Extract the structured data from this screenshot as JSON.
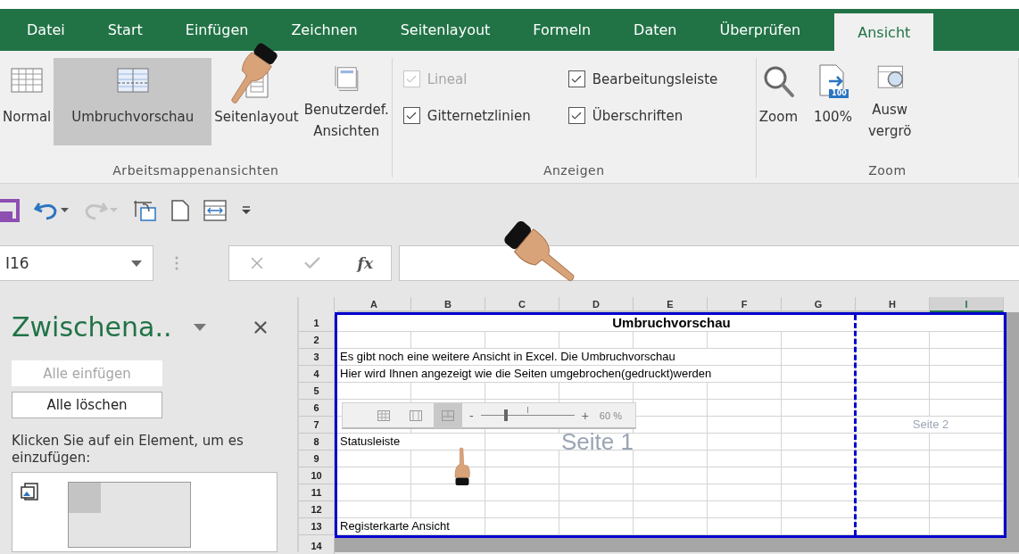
{
  "tabs": [
    {
      "label": "Datei",
      "selected": false
    },
    {
      "label": "Start",
      "selected": false
    },
    {
      "label": "Einfügen",
      "selected": false
    },
    {
      "label": "Zeichnen",
      "selected": false
    },
    {
      "label": "Seitenlayout",
      "selected": false
    },
    {
      "label": "Formeln",
      "selected": false
    },
    {
      "label": "Daten",
      "selected": false
    },
    {
      "label": "Überprüfen",
      "selected": false
    },
    {
      "label": "Ansicht",
      "selected": true
    }
  ],
  "ribbon": {
    "groups": [
      {
        "kind": "buttons",
        "label": "Arbeitsmappenansichten",
        "buttons": [
          {
            "kind": "normal",
            "lines": [
              "Normal"
            ],
            "selected": false
          },
          {
            "kind": "pagebreak",
            "lines": [
              "Umbruchvorschau"
            ],
            "selected": true
          },
          {
            "kind": "pagelayout",
            "lines": [
              "Seitenlayout"
            ],
            "selected": false
          },
          {
            "kind": "custom",
            "lines": [
              "Benutzerdef.",
              "Ansichten"
            ],
            "selected": false
          }
        ]
      },
      {
        "kind": "checks",
        "label": "Anzeigen",
        "checkboxes": [
          {
            "label": "Lineal",
            "checked": true,
            "disabled": true
          },
          {
            "label": "Bearbeitungsleiste",
            "checked": true,
            "disabled": false
          },
          {
            "label": "Gitternetzlinien",
            "checked": true,
            "disabled": false
          },
          {
            "label": "Überschriften",
            "checked": true,
            "disabled": false
          }
        ]
      },
      {
        "kind": "buttons",
        "label": "Zoom",
        "buttons": [
          {
            "kind": "zoom",
            "lines": [
              "Zoom"
            ],
            "selected": false
          },
          {
            "kind": "hundred",
            "lines": [
              "100%"
            ],
            "icon_text": "100",
            "selected": false
          },
          {
            "kind": "selection",
            "lines": [
              "Ausw",
              "vergrö"
            ],
            "selected": false
          }
        ]
      }
    ]
  },
  "quick_access": [
    {
      "kind": "save",
      "disabled": false
    },
    {
      "kind": "undo",
      "disabled": false
    },
    {
      "kind": "redo",
      "disabled": true
    },
    {
      "kind": "touch",
      "disabled": false
    },
    {
      "kind": "new",
      "disabled": false
    },
    {
      "kind": "freeze",
      "disabled": false
    },
    {
      "kind": "customize",
      "disabled": false
    }
  ],
  "formula_bar": {
    "name_box": "I16",
    "function_label": "fx"
  },
  "pane": {
    "title": "Zwischena..",
    "buttons": [
      {
        "label": "Alle einfügen",
        "disabled": true
      },
      {
        "label": "Alle löschen",
        "disabled": false
      }
    ],
    "instruction": "Klicken Sie auf ein Element, um es einzufügen:"
  },
  "sheet": {
    "columns": [
      {
        "label": "A",
        "selected": false
      },
      {
        "label": "B",
        "selected": false
      },
      {
        "label": "C",
        "selected": false
      },
      {
        "label": "D",
        "selected": false
      },
      {
        "label": "E",
        "selected": false
      },
      {
        "label": "F",
        "selected": false
      },
      {
        "label": "G",
        "selected": false
      },
      {
        "label": "H",
        "selected": false
      },
      {
        "label": "I",
        "selected": true
      }
    ],
    "rows": [
      {
        "number": "1",
        "kind": "title",
        "text": "Umbruchvorschau"
      },
      {
        "number": "2",
        "kind": "empty"
      },
      {
        "number": "3",
        "kind": "text",
        "text": "Es gibt noch eine weitere Ansicht in Excel. Die Umbruchvorschau"
      },
      {
        "number": "4",
        "kind": "text",
        "text": "Hier wird Ihnen angezeigt wie die Seiten umgebrochen(gedruckt)werden"
      },
      {
        "number": "5",
        "kind": "empty"
      },
      {
        "number": "6",
        "kind": "empty"
      },
      {
        "number": "7",
        "kind": "empty"
      },
      {
        "number": "8",
        "kind": "text",
        "text": "Statusleiste"
      },
      {
        "number": "9",
        "kind": "empty"
      },
      {
        "number": "10",
        "kind": "empty"
      },
      {
        "number": "11",
        "kind": "empty"
      },
      {
        "number": "12",
        "kind": "empty"
      },
      {
        "number": "13",
        "kind": "text",
        "text": "Registerkarte Ansicht"
      },
      {
        "number": "14",
        "kind": "outside"
      }
    ],
    "page_labels": [
      "Seite 1",
      "Seite 2"
    ],
    "status_overlay": {
      "views": [
        {
          "kind": "normal",
          "selected": false
        },
        {
          "kind": "pagelayout",
          "selected": false
        },
        {
          "kind": "pagebreak",
          "selected": true
        }
      ],
      "minus": "-",
      "plus": "+",
      "zoom": "60 %",
      "level": 0.27
    }
  }
}
